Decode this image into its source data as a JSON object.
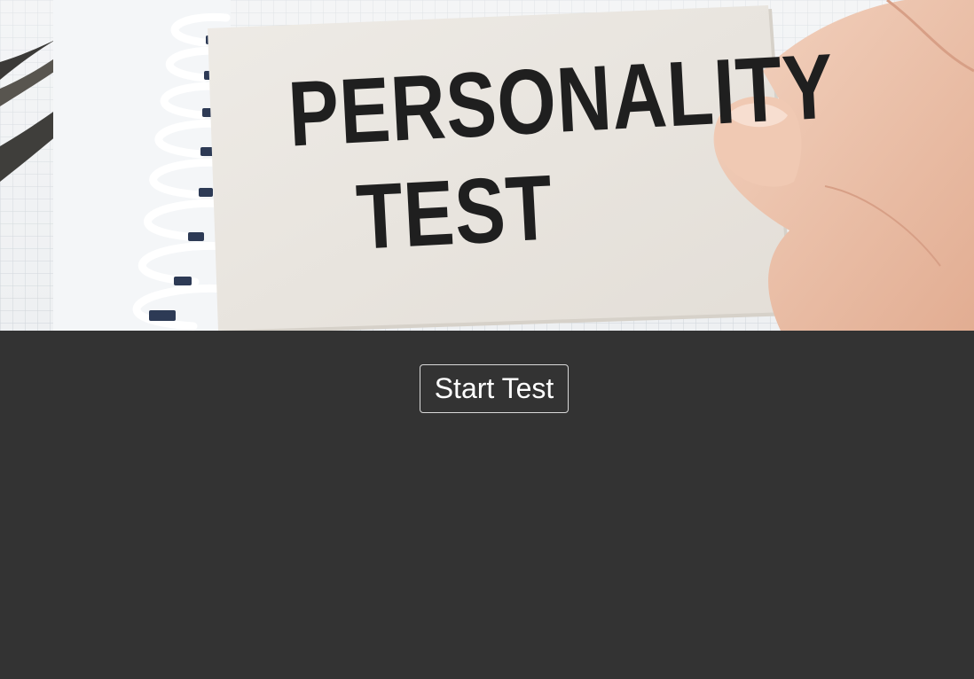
{
  "hero": {
    "card_line_1": "PERSONALITY",
    "card_line_2": "TEST"
  },
  "actions": {
    "start_label": "Start Test"
  },
  "colors": {
    "page_background": "#333333",
    "button_text": "#ffffff",
    "button_border": "#d9d9d9"
  }
}
